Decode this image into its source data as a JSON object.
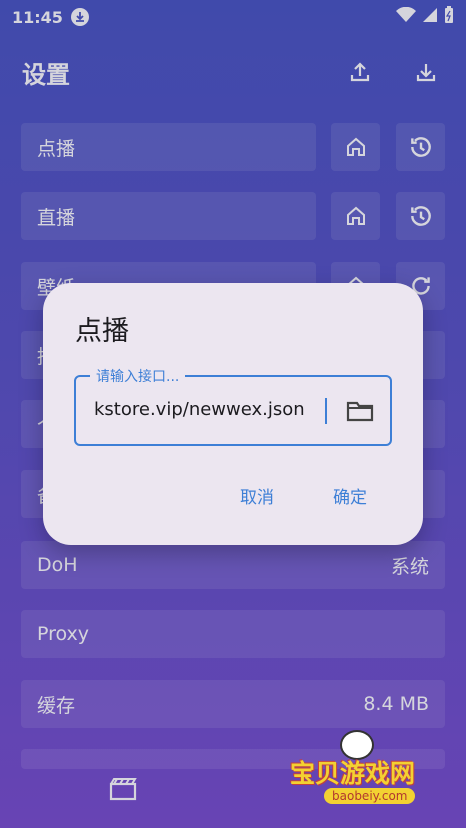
{
  "status_bar": {
    "time": "11:45"
  },
  "header": {
    "title": "设置"
  },
  "rows": [
    {
      "label": "点播"
    },
    {
      "label": "直播"
    },
    {
      "label": "壁纸"
    },
    {
      "label": "播"
    },
    {
      "label": "个"
    },
    {
      "label": "备"
    },
    {
      "label": "DoH",
      "value": "系统"
    },
    {
      "label": "Proxy",
      "value": ""
    },
    {
      "label": "缓存",
      "value": "8.4 MB"
    }
  ],
  "dialog": {
    "title": "点播",
    "field_label": "请输入接口...",
    "field_value": "kstore.vip/newwex.json",
    "cancel": "取消",
    "confirm": "确定"
  },
  "watermark": {
    "text": "宝贝游戏网",
    "sub": "baobeiy.com"
  },
  "colors": {
    "accent": "#3d7fd6",
    "dialog_bg": "#ece6f0",
    "bg_top": "#4a56c4",
    "bg_bottom": "#7a4fcf"
  }
}
